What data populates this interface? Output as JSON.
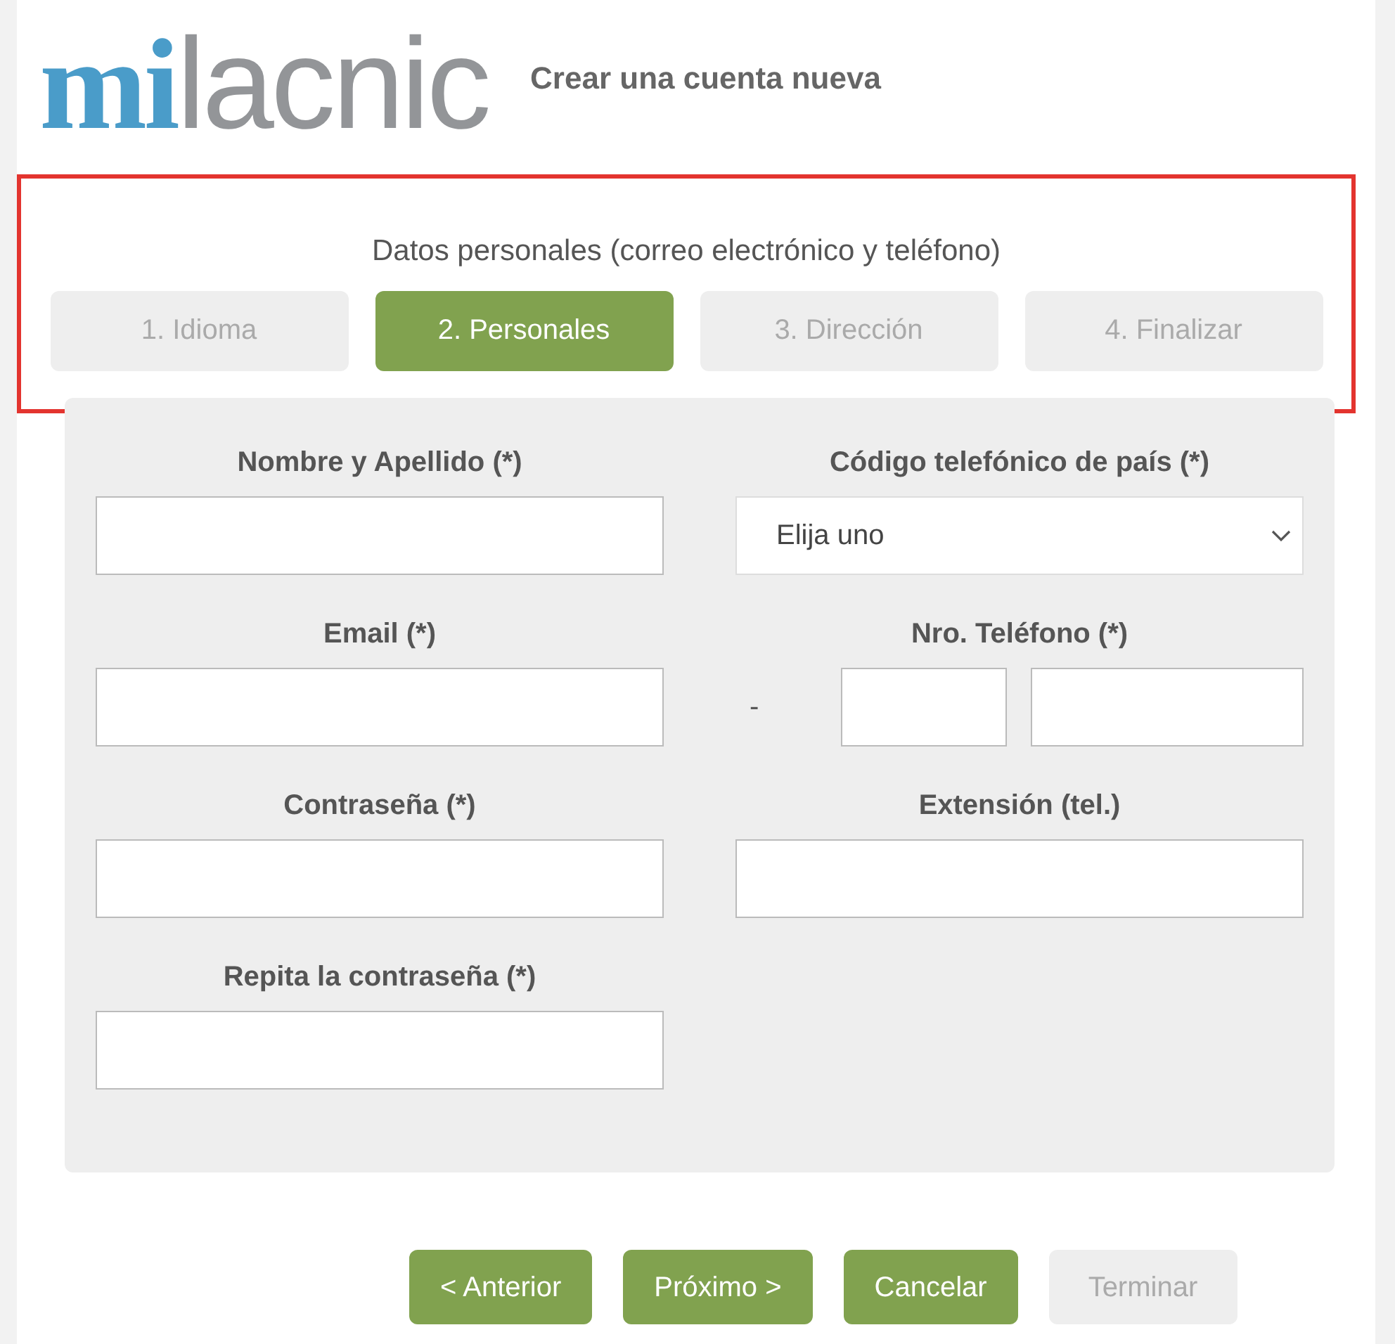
{
  "logo": {
    "part_1": "mi",
    "part_2": "lacnic"
  },
  "page_title": "Crear una cuenta nueva",
  "section_title": "Datos personales (correo electrónico y teléfono)",
  "steps": [
    {
      "label": "1. Idioma",
      "selected": false
    },
    {
      "label": "2. Personales",
      "selected": true
    },
    {
      "label": "3. Dirección",
      "selected": false
    },
    {
      "label": "4. Finalizar",
      "selected": false
    }
  ],
  "left_fields": [
    {
      "kind": "text",
      "label": "Nombre y Apellido (*)"
    },
    {
      "kind": "text",
      "label": "Email (*)"
    },
    {
      "kind": "text",
      "label": "Contraseña (*)"
    },
    {
      "kind": "text",
      "label": "Repita la contraseña (*)"
    }
  ],
  "right_fields": [
    {
      "kind": "select",
      "label": "Código telefónico de país (*)",
      "value": "Elija uno"
    },
    {
      "kind": "phone",
      "label": "Nro. Teléfono (*)",
      "separator": "-"
    },
    {
      "kind": "text",
      "label": "Extensión (tel.)"
    }
  ],
  "buttons": [
    {
      "label": "< Anterior",
      "disabled": false
    },
    {
      "label": "Próximo >",
      "disabled": false
    },
    {
      "label": "Cancelar",
      "disabled": false
    },
    {
      "label": "Terminar",
      "disabled": true
    }
  ]
}
